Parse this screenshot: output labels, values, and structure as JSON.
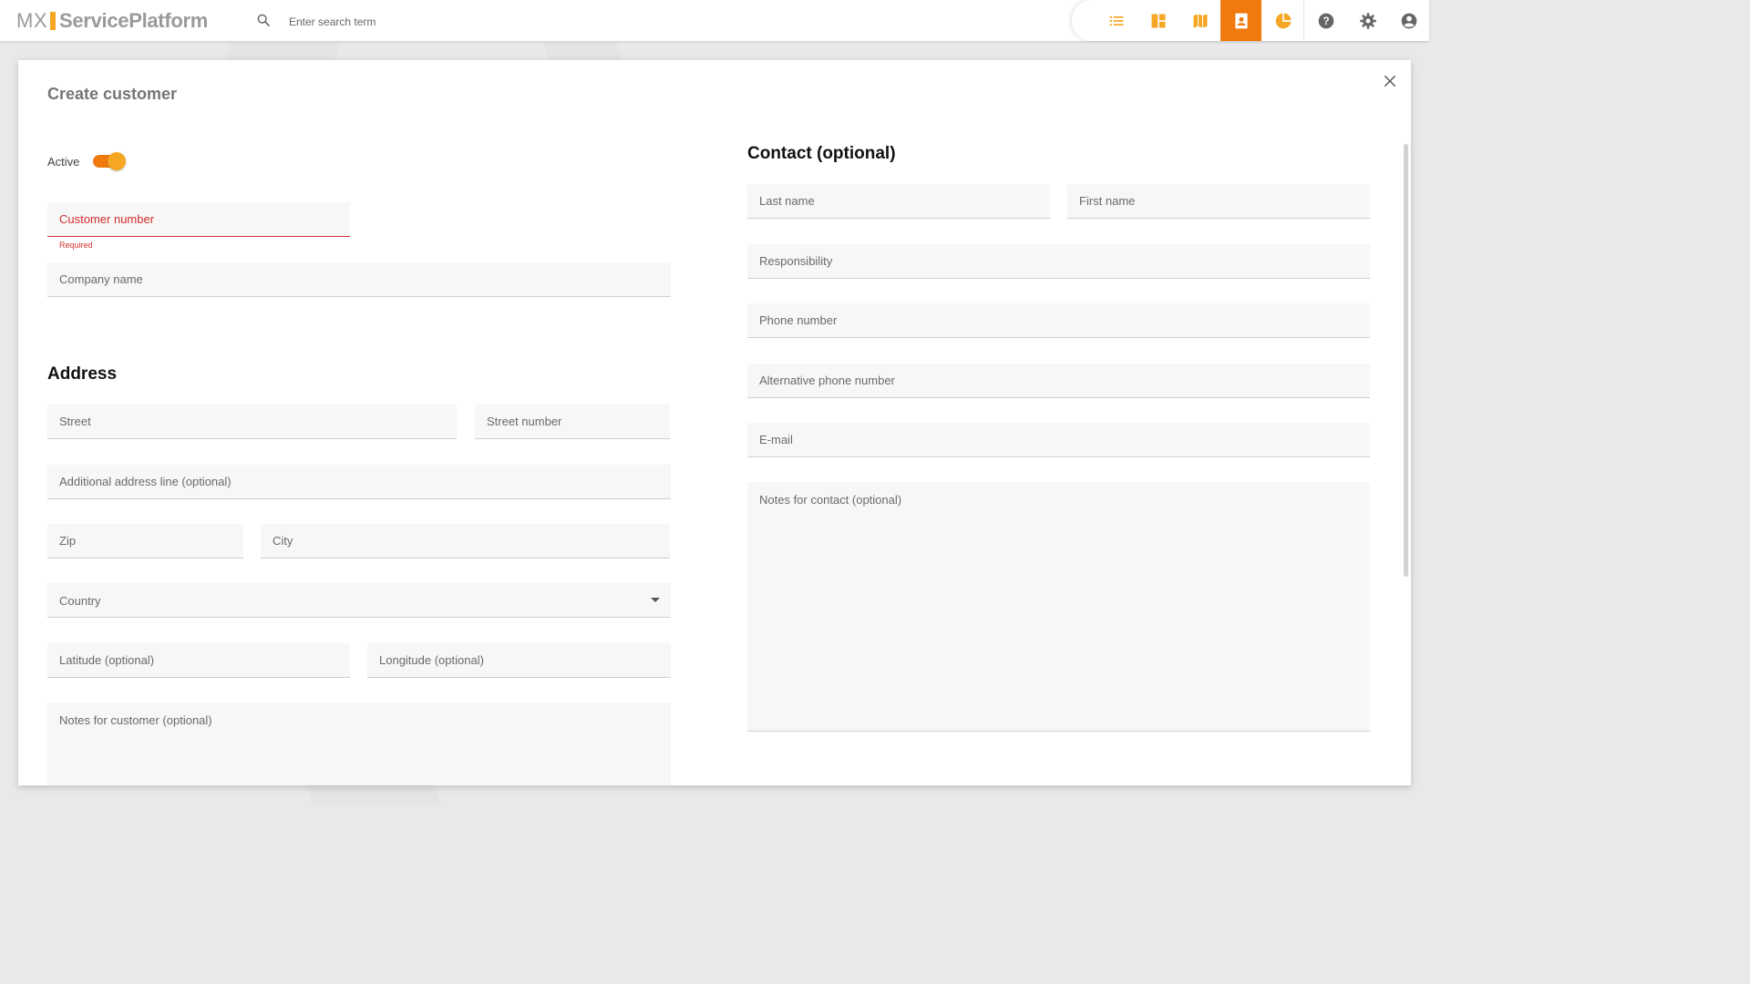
{
  "app": {
    "logo_mx": "MX",
    "logo_name": "ServicePlatform",
    "brand_color": "#f5a623",
    "accent_color": "#f07a0e"
  },
  "search": {
    "placeholder": "Enter search term",
    "icon": "search-icon"
  },
  "nav": {
    "items": [
      {
        "icon": "list-icon",
        "active": false
      },
      {
        "icon": "dashboard-icon",
        "active": false
      },
      {
        "icon": "map-icon",
        "active": false
      },
      {
        "icon": "contacts-icon",
        "active": true
      },
      {
        "icon": "pie-chart-icon",
        "active": false
      },
      {
        "icon": "help-icon",
        "active": false
      },
      {
        "icon": "settings-icon",
        "active": false
      },
      {
        "icon": "account-icon",
        "active": false
      }
    ]
  },
  "dialog": {
    "title": "Create customer",
    "close_icon": "close-icon",
    "active_label": "Active",
    "active_on": true,
    "customer_number": {
      "placeholder": "Customer number",
      "value": "",
      "helper": "Required"
    },
    "company_name": {
      "placeholder": "Company name",
      "value": ""
    },
    "address": {
      "title": "Address",
      "street": {
        "placeholder": "Street",
        "value": ""
      },
      "street_number": {
        "placeholder": "Street number",
        "value": ""
      },
      "additional_line": {
        "placeholder": "Additional address line (optional)",
        "value": ""
      },
      "zip": {
        "placeholder": "Zip",
        "value": ""
      },
      "city": {
        "placeholder": "City",
        "value": ""
      },
      "country": {
        "placeholder": "Country",
        "value": ""
      },
      "latitude": {
        "placeholder": "Latitude (optional)",
        "value": ""
      },
      "longitude": {
        "placeholder": "Longitude (optional)",
        "value": ""
      },
      "notes": {
        "placeholder": "Notes for customer (optional)",
        "value": ""
      }
    },
    "contact": {
      "title": "Contact (optional)",
      "last_name": {
        "placeholder": "Last name",
        "value": ""
      },
      "first_name": {
        "placeholder": "First name",
        "value": ""
      },
      "responsibility": {
        "placeholder": "Responsibility",
        "value": ""
      },
      "phone": {
        "placeholder": "Phone number",
        "value": ""
      },
      "alt_phone": {
        "placeholder": "Alternative phone number",
        "value": ""
      },
      "email": {
        "placeholder": "E-mail",
        "value": ""
      },
      "notes": {
        "placeholder": "Notes for contact (optional)",
        "value": ""
      }
    }
  }
}
